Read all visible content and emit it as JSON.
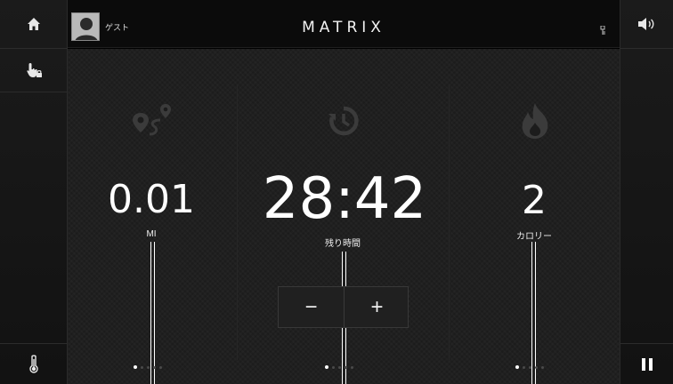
{
  "header": {
    "user_name": "ゲスト",
    "brand": "MATRIX"
  },
  "left_rail": {
    "home": "home-icon",
    "touch_lock": "touch-lock-icon",
    "temperature": "thermometer-icon"
  },
  "right_rail": {
    "volume": "volume-icon",
    "pause": "pause-icon"
  },
  "metrics": [
    {
      "icon": "route-map-icon",
      "value": "0.01",
      "label": "MI"
    },
    {
      "icon": "timer-icon",
      "value": "28:42",
      "label": "残り時間"
    },
    {
      "icon": "flame-icon",
      "value": "2",
      "label": "カロリー"
    }
  ],
  "stepper": {
    "minus": "−",
    "plus": "+"
  },
  "page_indicators": [
    {
      "active_index": 0,
      "count": 5
    },
    {
      "active_index": 0,
      "count": 5
    },
    {
      "active_index": 0,
      "count": 5
    }
  ],
  "colors": {
    "background": "#1c1c1c",
    "text": "#ffffff",
    "icon_muted": "#3a3a3a"
  }
}
